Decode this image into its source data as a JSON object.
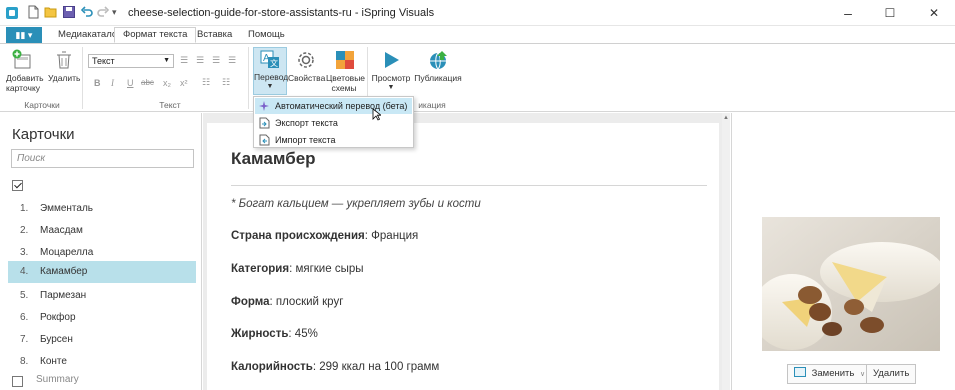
{
  "window": {
    "title": "cheese-selection-guide-for-store-assistants-ru - iSpring Visuals",
    "minimize": "–",
    "maximize": "☐",
    "close": "✕"
  },
  "ribbon_tabs": {
    "file": "▮▮ ▾",
    "tabs": [
      "Медиакаталог",
      "Формат текста",
      "Вставка",
      "Помощь"
    ]
  },
  "ribbon": {
    "cards_group": {
      "label": "Карточки",
      "add": "Добавить карточку",
      "delete": "Удалить"
    },
    "text_group": {
      "label": "Текст",
      "font_value": "Текст",
      "bold": "B",
      "italic": "I",
      "underline": "U",
      "strike": "abc",
      "sub": "x₂",
      "sup": "x²"
    },
    "translate": "Перевод",
    "properties": "Свойства",
    "color_schemes": "Цветовые схемы",
    "preview": "Просмотр",
    "publish": "Публикация",
    "publish_group_label": "икация"
  },
  "translate_menu": {
    "items": [
      "Автоматический перевод (бета)",
      "Экспорт текста",
      "Импорт текста"
    ]
  },
  "cards_panel": {
    "heading": "Карточки",
    "search_placeholder": "Поиск",
    "items": [
      {
        "num": "1.",
        "name": "Эмменталь"
      },
      {
        "num": "2.",
        "name": "Маасдам"
      },
      {
        "num": "3.",
        "name": "Моцарелла"
      },
      {
        "num": "4.",
        "name": "Камамбер"
      },
      {
        "num": "5.",
        "name": "Пармезан"
      },
      {
        "num": "6.",
        "name": "Рокфор"
      },
      {
        "num": "7.",
        "name": "Бурсен"
      },
      {
        "num": "8.",
        "name": "Конте"
      }
    ],
    "summary": "Summary"
  },
  "card": {
    "title": "Камамбер",
    "note": "* Богат кальцием — укрепляет зубы и кости",
    "fields": [
      {
        "label": "Страна происхождения",
        "value": ": Франция"
      },
      {
        "label": "Категория",
        "value": ": мягкие сыры"
      },
      {
        "label": "Форма",
        "value": ": плоский круг"
      },
      {
        "label": "Жирность",
        "value": ": 45%"
      },
      {
        "label": "Калорийность",
        "value": ": 299 ккал на 100 грамм"
      }
    ]
  },
  "image_panel": {
    "replace": "Заменить",
    "delete": "Удалить"
  },
  "colors": {
    "accent": "#2a8fb8",
    "selection": "#b8e0ea",
    "menu_highlight": "#c9e8f5"
  }
}
